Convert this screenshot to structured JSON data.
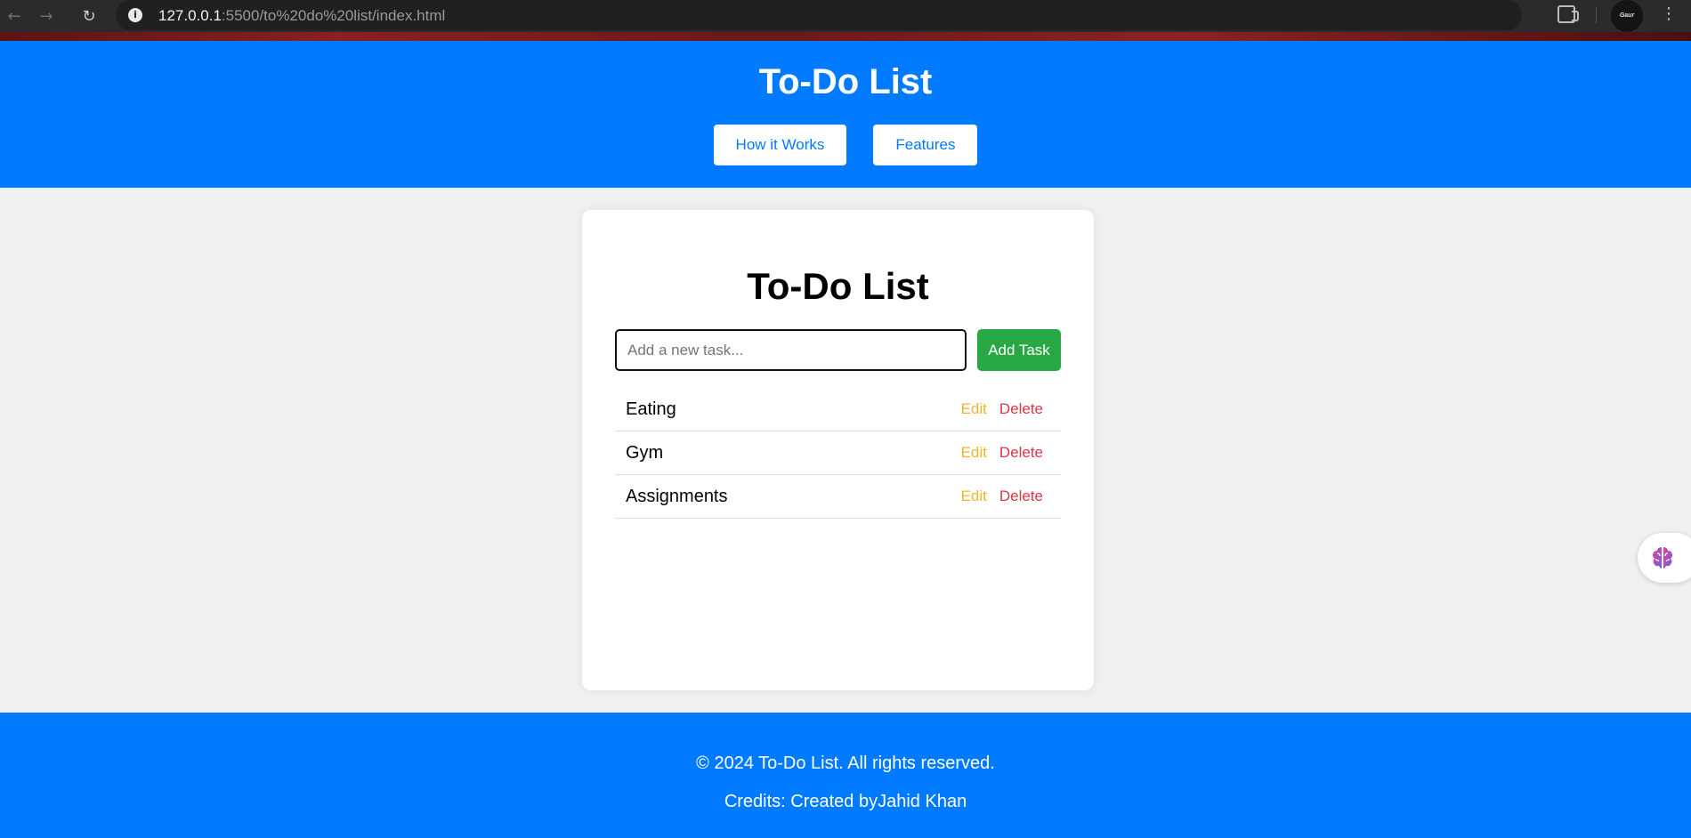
{
  "browser": {
    "url_host": "127.0.0.1",
    "url_path": ":5500/to%20do%20list/index.html",
    "avatar_text": "Gaur"
  },
  "header": {
    "title": "To-Do List",
    "nav": {
      "how_it_works": "How it Works",
      "features": "Features"
    }
  },
  "card": {
    "title": "To-Do List",
    "input_placeholder": "Add a new task...",
    "input_value": "",
    "add_button": "Add Task",
    "edit_label": "Edit",
    "delete_label": "Delete",
    "tasks": [
      {
        "text": "Eating"
      },
      {
        "text": "Gym"
      },
      {
        "text": "Assignments"
      }
    ]
  },
  "footer": {
    "copyright": "© 2024 To-Do List. All rights reserved.",
    "credits": "Credits: Created byJahid Khan"
  },
  "colors": {
    "primary": "#007bff",
    "add_button": "#28a745",
    "edit": "#f0b429",
    "delete": "#dc3545",
    "page_bg": "#f0f0f0"
  },
  "icons": {
    "info": "info-icon",
    "bookmark": "star-icon",
    "extensions": "puzzle-icon",
    "menu": "more-vertical-icon",
    "widget": "brain-icon"
  }
}
